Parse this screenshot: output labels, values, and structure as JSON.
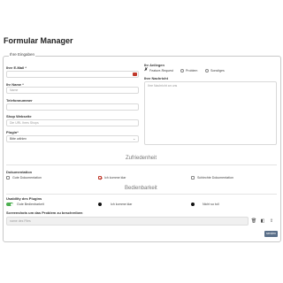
{
  "page": {
    "title": "Formular Manager"
  },
  "form": {
    "legend": "Ihre Eingaben",
    "email": {
      "label": "Ihre E-Mail *",
      "value": ""
    },
    "name": {
      "label": "Ihr Name *",
      "placeholder": "Name"
    },
    "phone": {
      "label": "Telefonnummer",
      "value": ""
    },
    "website": {
      "label": "Shop Webseite",
      "placeholder": "Die URL Ihres Shops"
    },
    "plugin": {
      "label": "Plugin*",
      "selected": "Bitte wählen"
    },
    "anliegen": {
      "label": "Ihr Anliegen",
      "options": [
        "Feature-Request",
        "Problem",
        "Sonstiges"
      ]
    },
    "message": {
      "label": "Ihre Nachricht",
      "placeholder": "Ihre Nachricht an uns"
    },
    "satisfaction": {
      "heading": "Zufriedenheit",
      "label": "Dokumentation",
      "options": [
        "Gute Dokumentation",
        "Ich komme klar",
        "Schlechte Dokumentation"
      ],
      "checked_index": 1
    },
    "usability": {
      "heading": "Bedienbarkeit",
      "label": "Usability des Plugins",
      "options": [
        "Gute Bedienbarkeit",
        "Ich komme klar",
        "Nicht so toll"
      ]
    },
    "screenshots": {
      "label": "Screenshots um das Problem zu beschreiben",
      "placeholder": "name des Files"
    },
    "submit_label": "senden"
  },
  "colors": {
    "accent": "#5a6f89",
    "toggle_on": "#4caf50",
    "error": "#c0392b"
  }
}
